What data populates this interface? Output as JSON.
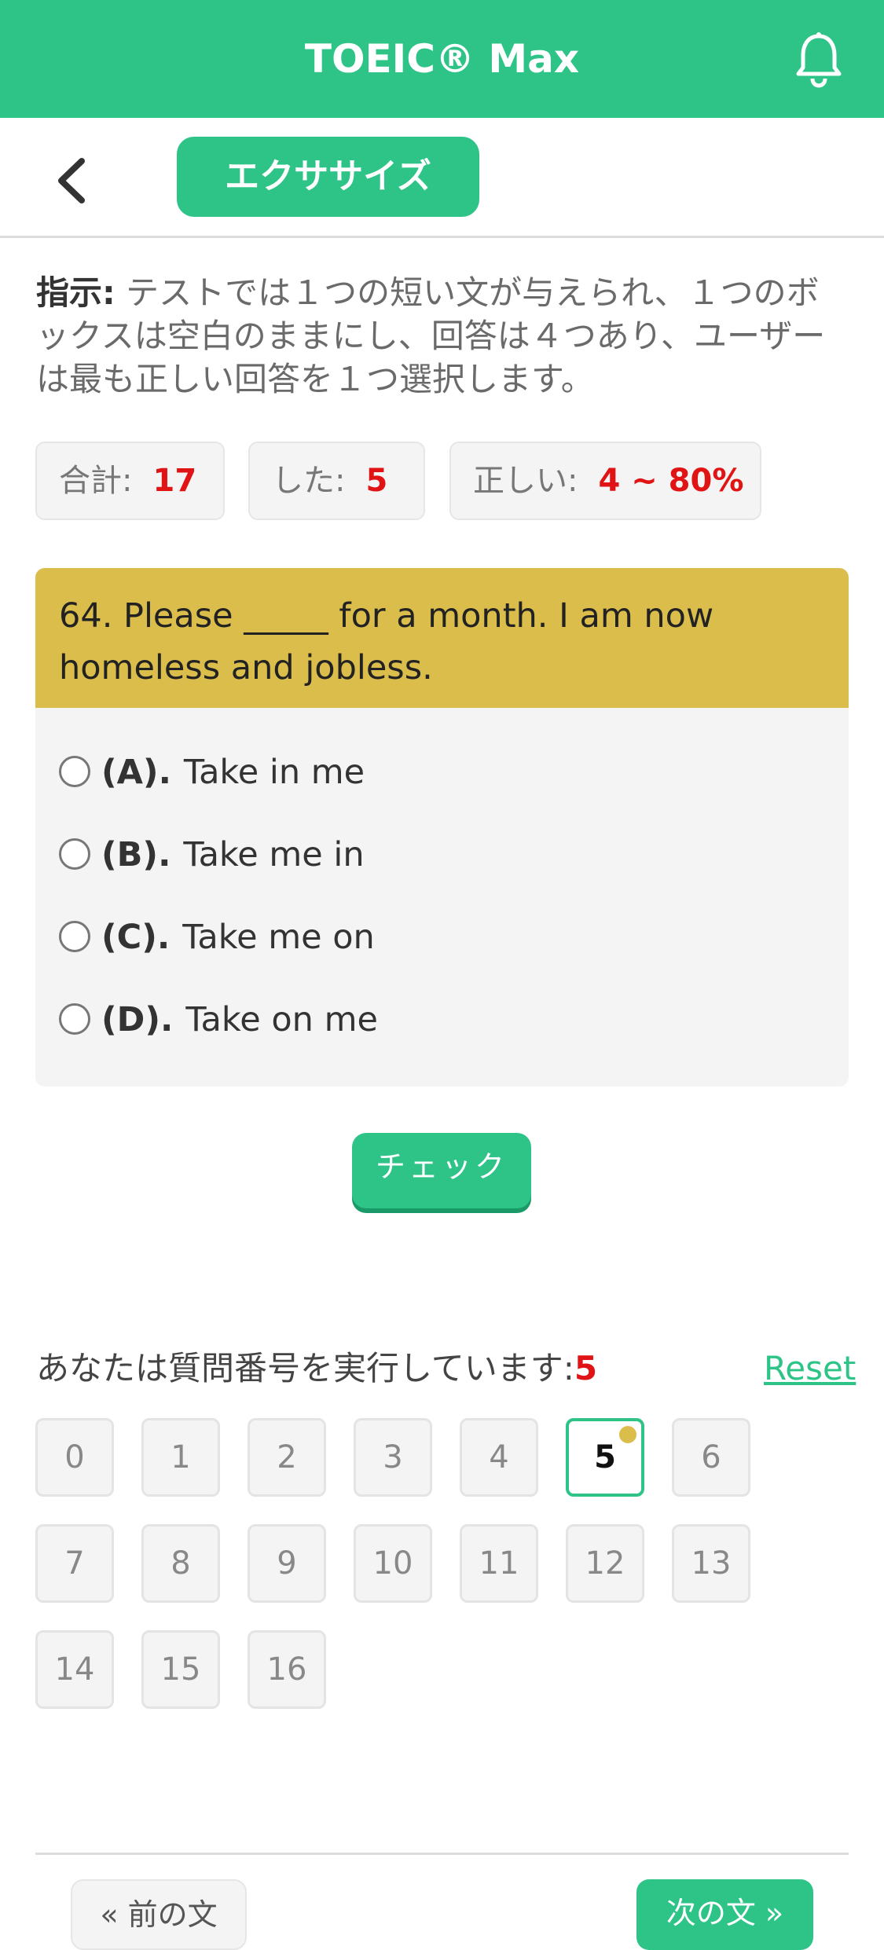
{
  "header": {
    "title": "TOEIC® Max",
    "bell_icon": "bell-icon"
  },
  "subnav": {
    "back_icon": "chevron-left-icon",
    "tab_label": "エクササイズ"
  },
  "instructions": {
    "label": "指示:",
    "text": " テストでは１つの短い文が与えられ、１つのボックスは空白のままにし、回答は４つあり、ユーザーは最も正しい回答を１つ選択します。"
  },
  "stats": {
    "total_label": "合計:",
    "total_value": "17",
    "done_label": "した:",
    "done_value": "5",
    "correct_label": "正しい:",
    "correct_value": "4 ~ 80%"
  },
  "question": {
    "text": "64. Please _____ for a month. I am now homeless and jobless.",
    "options": [
      {
        "key": "(A).",
        "text": "Take in me"
      },
      {
        "key": "(B).",
        "text": "Take me in"
      },
      {
        "key": "(C).",
        "text": "Take me on"
      },
      {
        "key": "(D).",
        "text": "Take on me"
      }
    ]
  },
  "check_label": "チェック",
  "progress": {
    "label": "あなたは質問番号を実行しています:",
    "current": "5",
    "reset_label": "Reset",
    "numbers": [
      "0",
      "1",
      "2",
      "3",
      "4",
      "5",
      "6",
      "7",
      "8",
      "9",
      "10",
      "11",
      "12",
      "13",
      "14",
      "15",
      "16"
    ]
  },
  "nav": {
    "prev_label": "« 前の文",
    "next_label": "次の文 »"
  },
  "colors": {
    "accent": "#2ec488",
    "question_bg": "#dbbd4c",
    "highlight": "#e01414"
  }
}
